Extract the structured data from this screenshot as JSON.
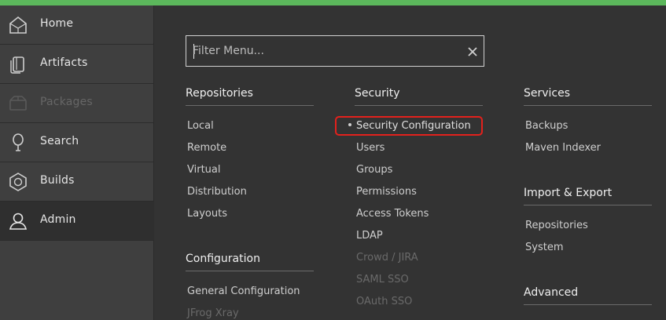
{
  "sidebar": {
    "items": [
      {
        "label": "Home",
        "icon": "home-icon"
      },
      {
        "label": "Artifacts",
        "icon": "artifacts-icon"
      },
      {
        "label": "Packages",
        "icon": "packages-icon"
      },
      {
        "label": "Search",
        "icon": "search-icon"
      },
      {
        "label": "Builds",
        "icon": "builds-icon"
      },
      {
        "label": "Admin",
        "icon": "admin-icon"
      }
    ]
  },
  "filter": {
    "placeholder": "Filter Menu...",
    "value": ""
  },
  "columns": {
    "repositories": {
      "title": "Repositories",
      "items": [
        "Local",
        "Remote",
        "Virtual",
        "Distribution",
        "Layouts"
      ]
    },
    "configuration": {
      "title": "Configuration",
      "items": [
        "General Configuration",
        "JFrog Xray"
      ]
    },
    "security": {
      "title": "Security",
      "items": [
        "Security Configuration",
        "Users",
        "Groups",
        "Permissions",
        "Access Tokens",
        "LDAP",
        "Crowd / JIRA",
        "SAML SSO",
        "OAuth SSO"
      ]
    },
    "services": {
      "title": "Services",
      "items": [
        "Backups",
        "Maven Indexer"
      ]
    },
    "import_export": {
      "title": "Import & Export",
      "items": [
        "Repositories",
        "System"
      ]
    },
    "advanced": {
      "title": "Advanced"
    }
  },
  "colors": {
    "accent_bar": "#5cb85c",
    "highlight_border": "#e3211c",
    "sidebar_bg": "#3f3f3f",
    "main_bg": "#333333"
  }
}
